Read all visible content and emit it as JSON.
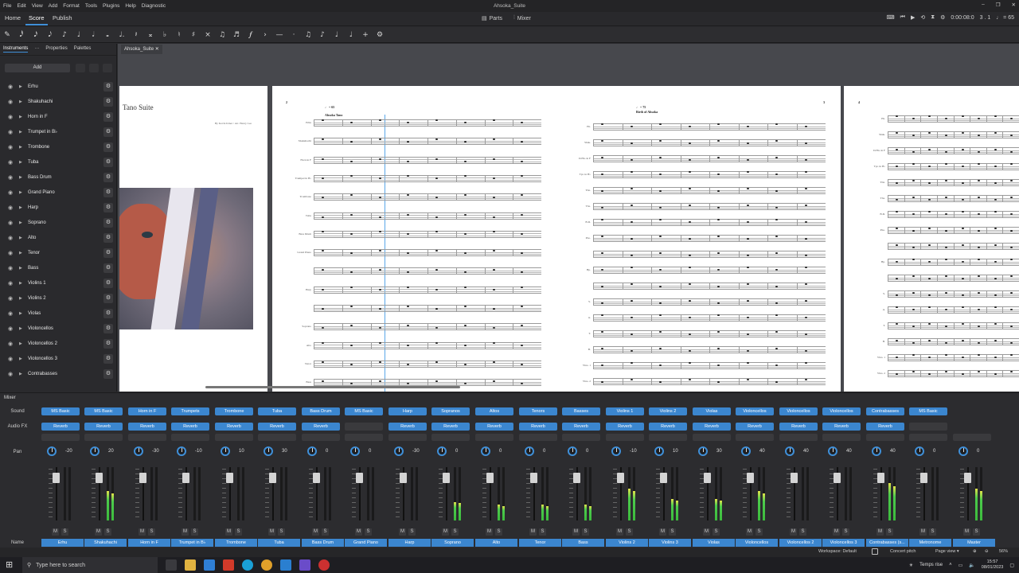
{
  "app": {
    "title": "Ahsoka_Suite"
  },
  "menu": [
    "File",
    "Edit",
    "View",
    "Add",
    "Format",
    "Tools",
    "Plugins",
    "Help",
    "Diagnostic"
  ],
  "tabs": [
    "Home",
    "Score",
    "Publish"
  ],
  "active_tab": "Score",
  "center_buttons": {
    "parts": "Parts",
    "mixer": "Mixer"
  },
  "playback": {
    "time": "0:00:08:0",
    "position": "3 . 1",
    "tempo": "♩ = 65"
  },
  "note_toolbar": [
    "✎",
    "𝅘𝅥𝅰",
    "𝅘𝅥𝅯",
    "𝅘𝅥𝅮",
    "♪",
    "♩",
    "𝅗𝅥",
    "𝅝",
    "♩.",
    "𝄽",
    "𝄪",
    "♭",
    "♮",
    "♯",
    "×",
    "♫",
    "♬",
    "𝆑",
    "›",
    "—",
    "·",
    "♫",
    "♪",
    "♩",
    "♩",
    "+",
    "⚙"
  ],
  "left_panel": {
    "tabs": [
      "Instruments",
      "Properties",
      "Palettes"
    ],
    "add_label": "Add",
    "instruments": [
      "Erhu",
      "Shakuhachi",
      "Horn in F",
      "Trumpet in B♭",
      "Trombone",
      "Tuba",
      "Bass Drum",
      "Grand Piano",
      "Harp",
      "Soprano",
      "Alto",
      "Tenor",
      "Bass",
      "Violins 1",
      "Violins 2",
      "Violas",
      "Violoncellos",
      "Violoncellos 2",
      "Violoncellos 3",
      "Contrabasses"
    ]
  },
  "score": {
    "doc_tab": "Ahsoka_Suite",
    "page1_title": "Tano Suite",
    "page1_composer": "By Kevin Kiner / Arr. Henry Lee",
    "page2_tempo": "♩ = 65",
    "page2_section": "Ahsoka Tano",
    "page2_number": "2",
    "page3_tempo": "♩ = 75",
    "page3_section": "Birth of Ahsoka",
    "page3_number": "3",
    "page4_number": "4",
    "page2_staves": [
      "Erhu",
      "Shakuhachi",
      "Horn in F",
      "Trumpet in B♭",
      "Trombone",
      "Tuba",
      "Bass Drum",
      "Grand Piano",
      "",
      "Harp",
      "",
      "Soprano",
      "Alto",
      "Tenor",
      "Bass",
      "Violins 1"
    ],
    "page3_staves": [
      "Eh.",
      "Shak.",
      "D.Hn. in F",
      "Tpt. in B♭",
      "Tbn.",
      "Tba.",
      "B.D.",
      "Pno.",
      "",
      "Hp.",
      "",
      "S.",
      "A.",
      "T.",
      "B.",
      "Vlns. 1",
      "Vlns. 2"
    ],
    "page4_staves": [
      "Eh.",
      "Shak.",
      "D.Hn. in F",
      "Tpt. in B♭",
      "Tbn.",
      "Tba.",
      "B.D.",
      "Pno.",
      "",
      "Hp.",
      "",
      "S.",
      "A.",
      "T.",
      "B.",
      "Vlns. 1",
      "Vlns. 2"
    ]
  },
  "mixer": {
    "title": "Mixer",
    "row_labels": {
      "sound": "Sound",
      "fx": "Audio FX",
      "pan": "Pan",
      "name": "Name"
    },
    "channels": [
      {
        "sound": "MS Basic",
        "fx": "Reverb",
        "pan": "-20",
        "name": "Erhu",
        "level": 0.0
      },
      {
        "sound": "MS Basic",
        "fx": "Reverb",
        "pan": "20",
        "name": "Shakuhachi",
        "level": 0.55
      },
      {
        "sound": "Horn in F",
        "fx": "Reverb",
        "pan": "-30",
        "name": "Horn in F",
        "level": 0.0
      },
      {
        "sound": "Trumpets",
        "fx": "Reverb",
        "pan": "-10",
        "name": "Trumpet in B♭",
        "level": 0.0
      },
      {
        "sound": "Trombone",
        "fx": "Reverb",
        "pan": "10",
        "name": "Trombone",
        "level": 0.0
      },
      {
        "sound": "Tuba",
        "fx": "Reverb",
        "pan": "30",
        "name": "Tuba",
        "level": 0.0
      },
      {
        "sound": "Bass Drum",
        "fx": "Reverb",
        "pan": "0",
        "name": "Bass Drum",
        "level": 0.0
      },
      {
        "sound": "MS Basic",
        "fx": "",
        "pan": "0",
        "name": "Grand Piano",
        "level": 0.0
      },
      {
        "sound": "Harp",
        "fx": "Reverb",
        "pan": "-30",
        "name": "Harp",
        "level": 0.0
      },
      {
        "sound": "Sopranos",
        "fx": "Reverb",
        "pan": "0",
        "name": "Soprano",
        "level": 0.35
      },
      {
        "sound": "Altos",
        "fx": "Reverb",
        "pan": "0",
        "name": "Alto",
        "level": 0.3
      },
      {
        "sound": "Tenors",
        "fx": "Reverb",
        "pan": "0",
        "name": "Tenor",
        "level": 0.3
      },
      {
        "sound": "Basses",
        "fx": "Reverb",
        "pan": "0",
        "name": "Bass",
        "level": 0.3
      },
      {
        "sound": "Violins 1",
        "fx": "Reverb",
        "pan": "-10",
        "name": "Violins 2",
        "level": 0.6
      },
      {
        "sound": "Violins 2",
        "fx": "Reverb",
        "pan": "10",
        "name": "Violins 3",
        "level": 0.4
      },
      {
        "sound": "Violas",
        "fx": "Reverb",
        "pan": "30",
        "name": "Violas",
        "level": 0.4
      },
      {
        "sound": "Violoncellos",
        "fx": "Reverb",
        "pan": "40",
        "name": "Violoncellos",
        "level": 0.55
      },
      {
        "sound": "Violoncellos",
        "fx": "Reverb",
        "pan": "40",
        "name": "Violoncellos 2",
        "level": 0.0
      },
      {
        "sound": "Violoncellos",
        "fx": "Reverb",
        "pan": "40",
        "name": "Violoncellos 3",
        "level": 0.0
      },
      {
        "sound": "Contrabasses",
        "fx": "Reverb",
        "pan": "40",
        "name": "Contrabasses (s...",
        "level": 0.7
      },
      {
        "sound": "MS Basic",
        "fx": "",
        "pan": "0",
        "name": "Metronome",
        "level": 0.0
      },
      {
        "sound": "",
        "fx": "",
        "pan": "0",
        "name": "Master",
        "level": 0.6
      }
    ],
    "mute": "M",
    "solo": "S"
  },
  "statusbar": {
    "workspace": "Workspace: Default",
    "concert_pitch": "Concert pitch",
    "page_view": "Page view ▾",
    "zoom": "56%"
  },
  "taskbar": {
    "search_placeholder": "Type here to search",
    "weather": "Temps rise",
    "time": "15:57",
    "date": "08/01/2023"
  }
}
